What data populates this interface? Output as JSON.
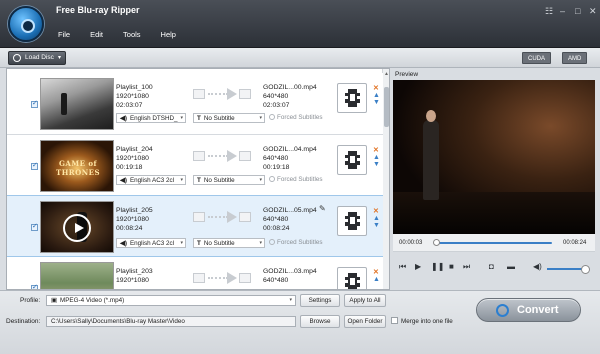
{
  "app": {
    "title": "Free Blu-ray Ripper"
  },
  "menu": [
    "File",
    "Edit",
    "Tools",
    "Help"
  ],
  "toolbar": {
    "load_disc": "Load Disc",
    "gpu1": "CUDA",
    "gpu2": "AMD"
  },
  "preview": {
    "label": "Preview",
    "time_current": "00:00:03",
    "time_total": "00:08:24"
  },
  "rows": [
    {
      "name": "Playlist_100",
      "res": "1920*1080",
      "dur": "02:03:07",
      "out_name": "GODZIL...00.mp4",
      "out_res": "640*480",
      "out_dur": "02:03:07",
      "audio": "English DTSHD_",
      "subtitle": "No Subtitle",
      "forced": "Forced Subtitles",
      "subtitle_icon": "T"
    },
    {
      "name": "Playlist_204",
      "res": "1920*1080",
      "dur": "00:19:18",
      "out_name": "GODZIL...04.mp4",
      "out_res": "640*480",
      "out_dur": "00:19:18",
      "audio": "English AC3 2cl",
      "subtitle": "No Subtitle",
      "forced": "Forced Subtitles",
      "subtitle_icon": "T",
      "thumb_text": "GAME of THRONES"
    },
    {
      "name": "Playlist_205",
      "res": "1920*1080",
      "dur": "00:08:24",
      "out_name": "GODZIL...05.mp4",
      "out_res": "640*480",
      "out_dur": "00:08:24",
      "audio": "English AC3 2cl",
      "subtitle": "No Subtitle",
      "forced": "Forced Subtitles",
      "subtitle_icon": "T"
    },
    {
      "name": "Playlist_203",
      "res": "1920*1080",
      "dur": "",
      "out_name": "GODZIL...03.mp4",
      "out_res": "640*480",
      "out_dur": ""
    }
  ],
  "bottom": {
    "profile_label": "Profile:",
    "profile_value": "MPEG-4 Video (*.mp4)",
    "settings": "Settings",
    "apply_all": "Apply to All",
    "dest_label": "Destination:",
    "dest_value": "C:\\Users\\Sally\\Documents\\Blu-ray Master\\Video",
    "browse": "Browse",
    "open_folder": "Open Folder",
    "merge": "Merge into one file",
    "convert": "Convert"
  },
  "colors": {
    "accent": "#3a7fc6",
    "remove": "#e07020",
    "titlebar": "#2c3037"
  }
}
